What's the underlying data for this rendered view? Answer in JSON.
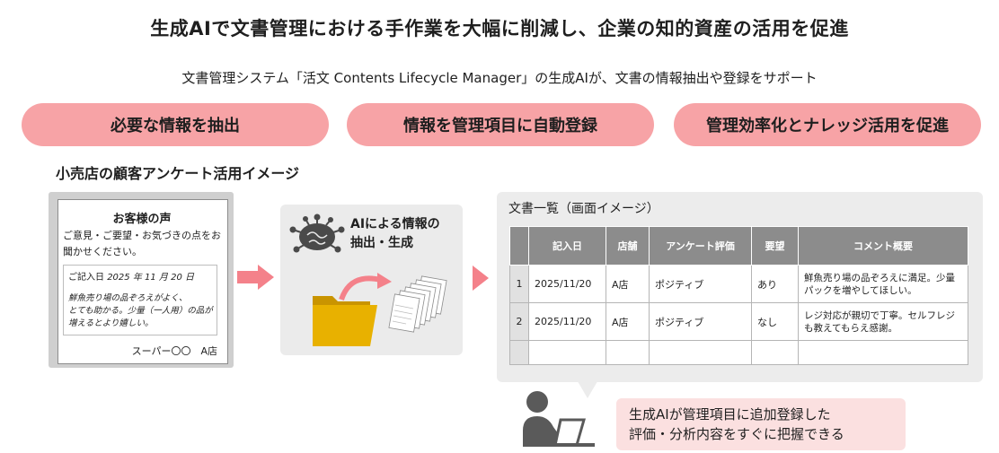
{
  "header": {
    "title": "生成AIで文書管理における手作業を大幅に削減し、企業の知的資産の活用を促進",
    "subtitle": "文書管理システム「活文 Contents Lifecycle Manager」の生成AIが、文書の情報抽出や登録をサポート"
  },
  "steps": [
    {
      "label": "必要な情報を抽出"
    },
    {
      "label": "情報を管理項目に自動登録"
    },
    {
      "label": "管理効率化とナレッジ活用を促進"
    }
  ],
  "section_label": "小売店の顧客アンケート活用イメージ",
  "survey_card": {
    "heading": "お客様の声",
    "intro": "ご意見・ご要望・お気づきの点をお聞かせください。",
    "date_prefix": "ご記入日",
    "date_value": "2025 年 11 月 20 日",
    "body_line1": "鮮魚売り場の品ぞろえがよく、",
    "body_line2": "とても助かる。少量（一人用）の品が",
    "body_line3": "増えるとより嬉しい。",
    "store": "スーパー〇〇　A店"
  },
  "ai_step": {
    "line1": "AIによる情報の",
    "line2": "抽出・生成"
  },
  "document_list": {
    "title": "文書一覧（画面イメージ）",
    "columns": [
      "",
      "記入日",
      "店舗",
      "アンケート評価",
      "要望",
      "コメント概要"
    ],
    "rows": [
      {
        "no": "1",
        "date": "2025/11/20",
        "store": "A店",
        "rating": "ポジティブ",
        "request": "あり",
        "comment": "鮮魚売り場の品ぞろえに満足。少量パックを増やしてほしい。"
      },
      {
        "no": "2",
        "date": "2025/11/20",
        "store": "A店",
        "rating": "ポジティブ",
        "request": "なし",
        "comment": "レジ対応が親切で丁寧。セルフレジも教えてもらえ感謝。"
      }
    ]
  },
  "callout": {
    "line1": "生成AIが管理項目に追加登録した",
    "line2": "評価・分析内容をすぐに把握できる"
  },
  "colors": {
    "accent_pink": "#f7a3a6",
    "arrow_pink": "#f4818a",
    "folder_gold": "#e8b100",
    "table_header": "#8c8c8c"
  },
  "icons": [
    "brain-network-icon",
    "folder-icon",
    "documents-stack-icon",
    "person-laptop-icon"
  ]
}
